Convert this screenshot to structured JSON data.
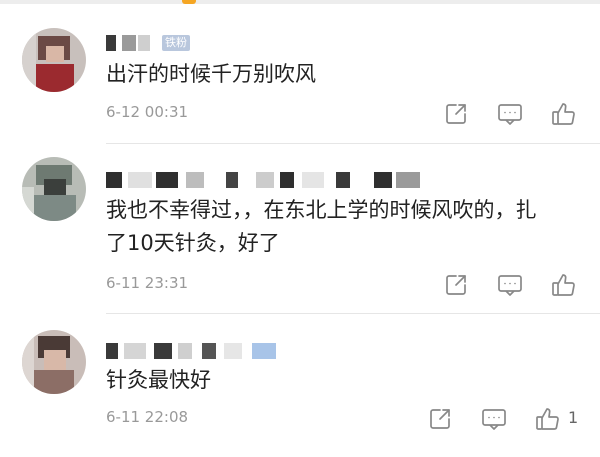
{
  "comments": [
    {
      "name": "",
      "badge": "铁粉",
      "text": "出汗的时候千万别吹风",
      "time": "6-12 00:31",
      "like_count": ""
    },
    {
      "name": "",
      "badge": "",
      "text": "我也不幸得过，，在东北上学的时候风吹的，扎了10天针灸，好了",
      "time": "6-11 23:31",
      "like_count": ""
    },
    {
      "name": "",
      "badge": "",
      "text": "针灸最快好",
      "time": "6-11 22:08",
      "like_count": "1"
    }
  ],
  "icons": {
    "share": "share-icon",
    "comment": "comment-icon",
    "like": "like-icon"
  },
  "colors": {
    "text": "#222222",
    "meta": "#999999",
    "icon": "#888888",
    "badge": "#b9c7dd"
  }
}
